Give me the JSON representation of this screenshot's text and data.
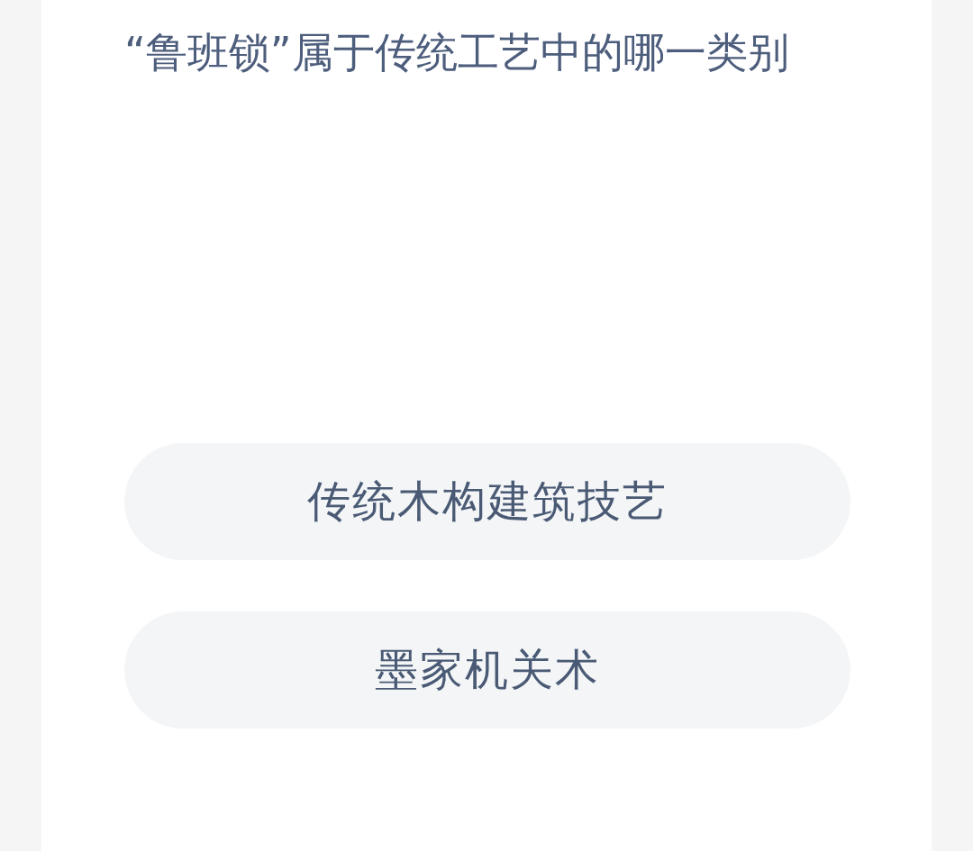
{
  "question": "“鲁班锁”属于传统工艺中的哪一类别",
  "options": [
    {
      "label": "传统木构建筑技艺"
    },
    {
      "label": "墨家机关术"
    }
  ]
}
